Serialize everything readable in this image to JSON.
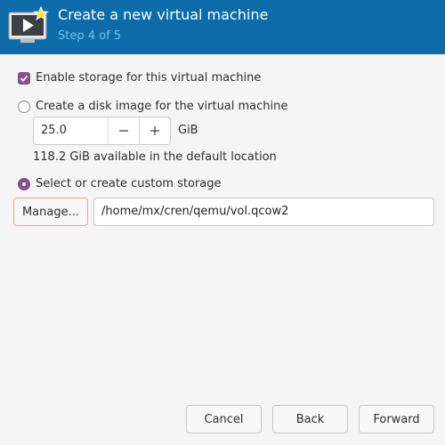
{
  "header": {
    "title": "Create a new virtual machine",
    "step": "Step 4 of 5",
    "icon": "virtual-machine-icon",
    "background": "#0c6ba8",
    "step_color": "#6fc2f0"
  },
  "storage": {
    "enable_label": "Enable storage for this virtual machine",
    "enable_checked": true,
    "disk_image_label": "Create a disk image for the virtual machine",
    "disk_image_selected": false,
    "size_value": "25.0",
    "size_unit": "GiB",
    "available_text": "118.2 GiB available in the default location",
    "custom_label": "Select or create custom storage",
    "custom_selected": true,
    "manage_label": "Manage...",
    "path_value": "/home/mx/cren/qemu/vol.qcow2"
  },
  "buttons": {
    "cancel": "Cancel",
    "back": "Back",
    "forward": "Forward"
  },
  "accent": "#8a4e8c"
}
